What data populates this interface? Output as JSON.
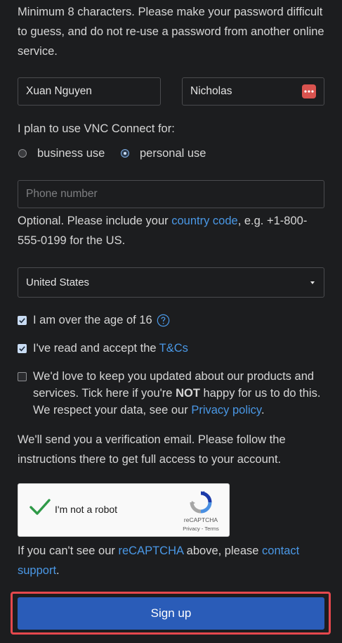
{
  "password_hint": "Minimum 8 characters. Please make your password difficult to guess, and do not re-use a password from another online service.",
  "first_name": {
    "value": "Xuan Nguyen"
  },
  "last_name": {
    "value": "Nicholas"
  },
  "usage": {
    "prompt": "I plan to use VNC Connect for:",
    "options": [
      {
        "label": "business use",
        "selected": false
      },
      {
        "label": "personal use",
        "selected": true
      }
    ]
  },
  "phone": {
    "placeholder": "Phone number",
    "help_before": "Optional. Please include your ",
    "help_link": "country code",
    "help_after": ", e.g. +1-800-555-0199 for the US."
  },
  "country": {
    "value": "United States"
  },
  "age_check": {
    "label": "I am over the age of 16",
    "checked": true,
    "help_icon": "question-circle-icon"
  },
  "terms_check": {
    "label_before": "I've read and accept the ",
    "link": "T&Cs",
    "checked": true
  },
  "marketing_check": {
    "checked": false,
    "text_before": "We'd love to keep you updated about our products and services. Tick here if you're ",
    "text_bold": "NOT",
    "text_mid": " happy for us to do this. We respect your data, see our ",
    "link": "Privacy policy",
    "text_after": "."
  },
  "verification_note": "We'll send you a verification email. Please follow the instructions there to get full access to your account.",
  "recaptcha": {
    "label": "I'm not a robot",
    "brand": "reCAPTCHA",
    "privacy": "Privacy",
    "separator": " - ",
    "terms": "Terms",
    "checked": true
  },
  "recaptcha_note": {
    "before": "If you can't see our ",
    "link1": "reCAPTCHA",
    "middle": " above, please ",
    "link2": "contact support",
    "after": "."
  },
  "signup": {
    "label": "Sign up"
  },
  "colors": {
    "background": "#1c1d1f",
    "link": "#4a98e6",
    "button": "#2a5cb8",
    "highlight": "#e5484d",
    "password_manager": "#d9534f"
  }
}
